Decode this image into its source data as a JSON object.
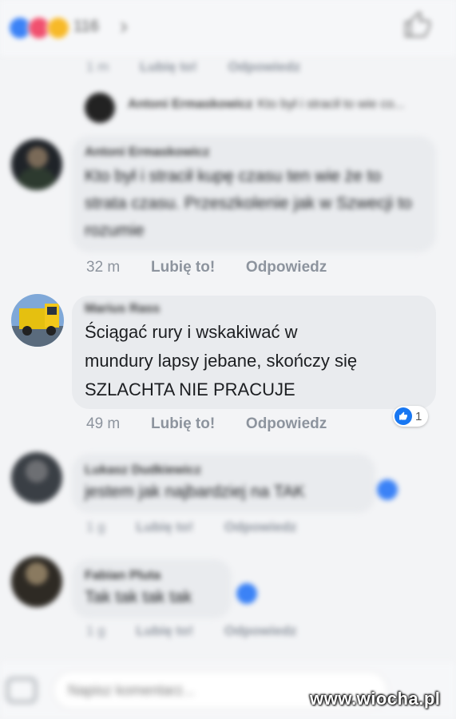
{
  "top": {
    "reaction_count": "116",
    "chevron": "›",
    "thumb_icon": "thumb-up-icon"
  },
  "meta_top": {
    "time": "1 m",
    "like": "Lubię to!",
    "reply": "Odpowiedz"
  },
  "reply_preview": {
    "name": "Antoni Ermaskowicz",
    "text": "Kto był i stracił to wie co..."
  },
  "comments": [
    {
      "name": "Antoni Ermaskowicz",
      "text": "Kto był i stracił kupę czasu ten wie że to strata czasu.  Przeszkolenie jak w Szwecji to rozumie",
      "time": "32 m",
      "like": "Lubię to!",
      "reply": "Odpowiedz"
    },
    {
      "name": "Marius Rass",
      "text_lines": [
        "Ściągać rury i wskakiwać w",
        "mundury lapsy jebane, skończy się",
        "SZLACHTA NIE PRACUJE"
      ],
      "time": "49 m",
      "like": "Lubię to!",
      "reply": "Odpowiedz",
      "reaction_count": "1"
    },
    {
      "name": "Lukasz Dudkiewicz",
      "text": "jestem jak najbardziej na TAK",
      "time": "1 g",
      "like": "Lubię to!",
      "reply": "Odpowiedz"
    },
    {
      "name": "Fabian Pluta",
      "text": "Tak tak tak tak",
      "time": "1 g",
      "like": "Lubię to!",
      "reply": "Odpowiedz"
    }
  ],
  "composer": {
    "placeholder": "Napisz komentarz..."
  },
  "watermark": "www.wiocha.pl",
  "colors": {
    "accent": "#1877f2",
    "bubble": "#e9ebee",
    "meta": "#8d949e"
  }
}
